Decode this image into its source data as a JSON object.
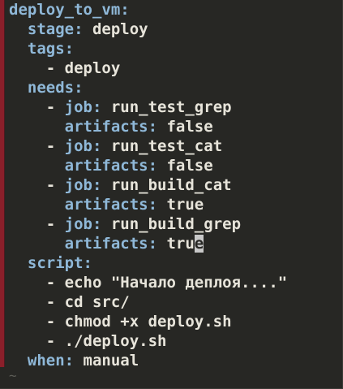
{
  "lines": [
    {
      "indent": "",
      "dash": "",
      "key": "deploy_to_vm:",
      "value": ""
    },
    {
      "indent": "  ",
      "dash": "",
      "key": "stage:",
      "value": " deploy"
    },
    {
      "indent": "  ",
      "dash": "",
      "key": "tags:",
      "value": ""
    },
    {
      "indent": "    ",
      "dash": "- ",
      "key": "",
      "value": "deploy"
    },
    {
      "indent": "  ",
      "dash": "",
      "key": "needs:",
      "value": ""
    },
    {
      "indent": "    ",
      "dash": "- ",
      "key": "job:",
      "value": " run_test_grep"
    },
    {
      "indent": "      ",
      "dash": "",
      "key": "artifacts:",
      "value": " false"
    },
    {
      "indent": "    ",
      "dash": "- ",
      "key": "job:",
      "value": " run_test_cat"
    },
    {
      "indent": "      ",
      "dash": "",
      "key": "artifacts:",
      "value": " false"
    },
    {
      "indent": "    ",
      "dash": "- ",
      "key": "job:",
      "value": " run_build_cat"
    },
    {
      "indent": "      ",
      "dash": "",
      "key": "artifacts:",
      "value": " true"
    },
    {
      "indent": "    ",
      "dash": "- ",
      "key": "job:",
      "value": " run_build_grep"
    },
    {
      "indent": "      ",
      "dash": "",
      "key": "artifacts:",
      "value": " tru",
      "cursor": "e"
    },
    {
      "indent": "  ",
      "dash": "",
      "key": "script:",
      "value": ""
    },
    {
      "indent": "    ",
      "dash": "- ",
      "key": "",
      "value": "echo \"Начало деплоя....\""
    },
    {
      "indent": "    ",
      "dash": "- ",
      "key": "",
      "value": "cd src/"
    },
    {
      "indent": "    ",
      "dash": "- ",
      "key": "",
      "value": "chmod +x deploy.sh"
    },
    {
      "indent": "    ",
      "dash": "- ",
      "key": "",
      "value": "./deploy.sh"
    },
    {
      "indent": "  ",
      "dash": "",
      "key": "when:",
      "value": " manual"
    }
  ],
  "empty_line_marker": "~",
  "colors": {
    "background": "#272724",
    "key": "#8fb8d8",
    "text": "#e7e4da",
    "gutter": "#8a1f2a",
    "cursor": "#c8c8c8",
    "tilde": "#5d5d57"
  }
}
